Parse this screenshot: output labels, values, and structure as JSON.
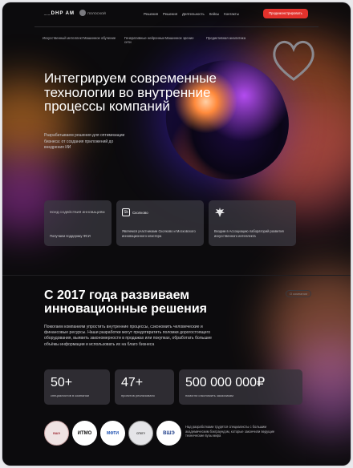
{
  "nav": {
    "logo": "__DHP AM",
    "badge": "ПОЛОСКОЙ",
    "menu": [
      "Решения",
      "Решения",
      "Деятельность",
      "Кейсы",
      "Контакты"
    ],
    "cta": "Продемонстрировать"
  },
  "categories": [
    "Искусственный интеллект",
    "Машинное обучение",
    "Генеративные нейронные сети",
    "Машинное зрение",
    "Предиктивная аналитика"
  ],
  "hero": {
    "title": "Интегрируем современные технологии во внутренние процессы компаний",
    "subtitle": "Разрабатываем решения для оптимизации бизнеса: от создания приложений до внедрения ИИ"
  },
  "cards": [
    {
      "logo": "ФОНД СОДЕЙСТВИЯ ИННОВАЦИЯМ",
      "text": "Получаем поддержку ФСИ"
    },
    {
      "logo": "Сколково",
      "logo_mark": "Sk",
      "text": "Являемся участниками Сколково и Московского инновационного кластера"
    },
    {
      "logo": "emblem",
      "text": "Входим в Ассоциацию лабораторий развития искусственного интеллекта"
    }
  ],
  "section": {
    "title": "С 2017 года развиваем инновационные решения",
    "pill": "О компании",
    "text": "Помогаем компаниям упростить внутренние процессы, сэкономить человеческие и финансовые ресурсы. Наши разработки могут предотвратить поломки дорогостоящего оборудования, выявить закономерности в продажах или покупках, обработать большие объёмы информации и использовать их на благо бизнеса"
  },
  "stats": [
    {
      "value": "50+",
      "label": "специалистов в компании"
    },
    {
      "value": "47+",
      "label": "проектов реализовано"
    },
    {
      "value": "500 000 000₽",
      "label": "помогли сэкономить заказчикам"
    }
  ],
  "partners": [
    "ВШЭ",
    "ИТМО",
    "МФТИ",
    "СПбГУ",
    "ВШЭ"
  ],
  "partners_note": "Над разработками трудятся специалисты с большим академическим бэкграундом, которые закончили ведущие технические вузы мира",
  "colors": {
    "accent": "#e3322c",
    "background": "#0c0b0d"
  }
}
